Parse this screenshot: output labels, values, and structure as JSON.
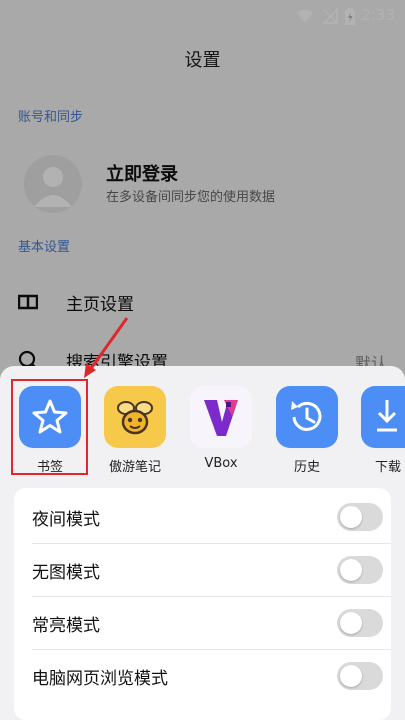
{
  "status": {
    "time": "2:33"
  },
  "header": {
    "title": "设置"
  },
  "account": {
    "section_label": "账号和同步",
    "login_title": "立即登录",
    "login_subtitle": "在多设备间同步您的使用数据"
  },
  "basic": {
    "section_label": "基本设置",
    "items": [
      {
        "label": "主页设置",
        "icon": "home-page-icon",
        "value": ""
      },
      {
        "label": "搜索引擎设置",
        "icon": "search-icon",
        "value": "默认"
      }
    ]
  },
  "sheet": {
    "apps": [
      {
        "label": "书签",
        "icon": "bookmark-star-icon",
        "color": "#4c8ef5"
      },
      {
        "label": "傲游笔记",
        "icon": "bee-notes-icon",
        "color": "#f6c94a"
      },
      {
        "label": "VBox",
        "icon": "vbox-icon",
        "color": "#7a2bc9"
      },
      {
        "label": "历史",
        "icon": "history-clock-icon",
        "color": "#4c8ef5"
      },
      {
        "label": "下载",
        "icon": "download-icon",
        "color": "#4c8ef5"
      }
    ],
    "toggles": [
      {
        "label": "夜间模式",
        "on": false
      },
      {
        "label": "无图模式",
        "on": false
      },
      {
        "label": "常亮模式",
        "on": false
      },
      {
        "label": "电脑网页浏览模式",
        "on": false
      }
    ]
  },
  "colors": {
    "accent": "#4c8ef5",
    "highlight": "#e0282c",
    "section": "#4a7bd0"
  }
}
